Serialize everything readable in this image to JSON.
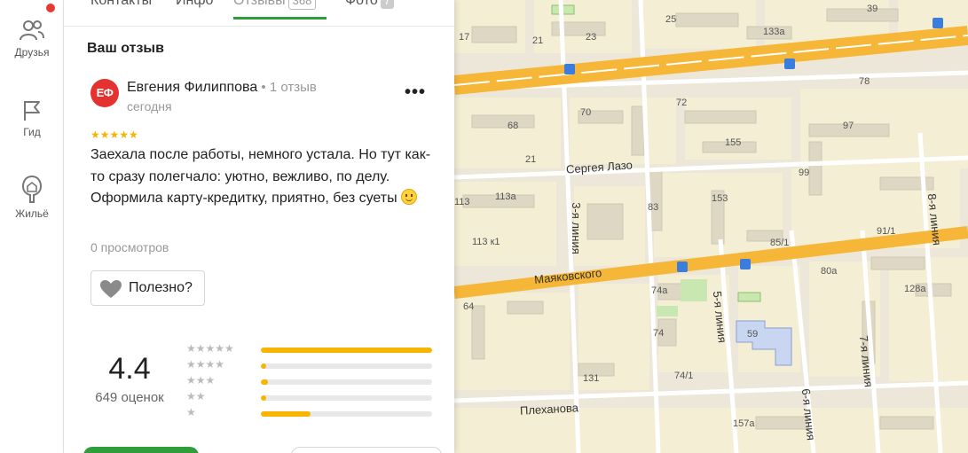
{
  "rail": {
    "items": [
      {
        "label": "Друзья",
        "icon": "people-icon"
      },
      {
        "label": "Гид",
        "icon": "flag-icon"
      },
      {
        "label": "Жильё",
        "icon": "house-icon"
      }
    ]
  },
  "tabs": [
    {
      "label": "Контакты",
      "count": ""
    },
    {
      "label": "Инфо",
      "count": ""
    },
    {
      "label": "Отзывы",
      "count": "368"
    },
    {
      "label": "Фото",
      "count": "7"
    }
  ],
  "section_title": "Ваш отзыв",
  "review": {
    "avatar_initials": "ЕФ",
    "author": "Евгения Филиппова",
    "author_meta": " • 1 отзыв",
    "date": "сегодня",
    "more": "•••",
    "stars": "★★★★★",
    "text": "Заехала после работы, немного устала. Но тут как-то сразу полегчало: уютно, вежливо, по делу. Оформила карту-кредитку, приятно, без суеты ",
    "views": "0 просмотров",
    "useful_label": "Полезно?"
  },
  "rating": {
    "value": "4.4",
    "count_label": "649 оценок",
    "distribution": [
      {
        "stars": "★★★★★",
        "fill": 1.0
      },
      {
        "stars": "★★★★",
        "fill": 0.03
      },
      {
        "stars": "★★★",
        "fill": 0.04
      },
      {
        "stars": "★★",
        "fill": 0.02
      },
      {
        "stars": "★",
        "fill": 0.29
      }
    ]
  },
  "colors": {
    "accent": "#2e9e3a",
    "star": "#f7b500",
    "avatar": "#e5312f",
    "road": "#f6b637"
  },
  "map": {
    "streets": [
      "Сергея Лазо",
      "Маяковского",
      "Плеханова",
      "3-я линия",
      "5-я линия",
      "6-я линия",
      "7-я линия",
      "8-я линия"
    ],
    "numbers": [
      "17",
      "21",
      "23",
      "25",
      "133а",
      "39",
      "68",
      "70",
      "72",
      "78",
      "97",
      "155",
      "21",
      "99",
      "113",
      "113а",
      "83",
      "153",
      "113 к1",
      "85/1",
      "91/1",
      "64",
      "74а",
      "80а",
      "128а",
      "74",
      "59",
      "131",
      "74/1",
      "157а"
    ]
  }
}
